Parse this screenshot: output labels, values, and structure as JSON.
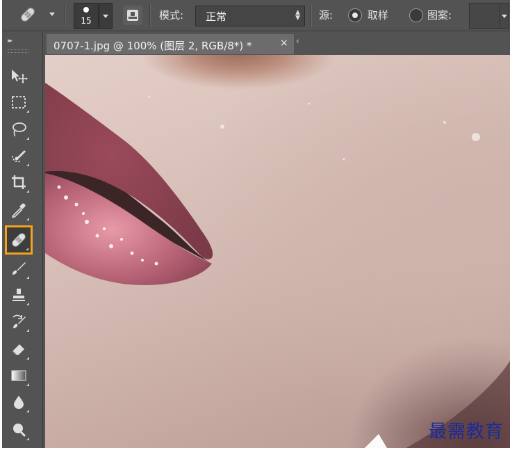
{
  "options_bar": {
    "brush_size": "15",
    "mode_label": "模式:",
    "mode_value": "正常",
    "source_label": "源:",
    "sampled_label": "取样",
    "pattern_label": "图案:",
    "sampled_selected": true
  },
  "document": {
    "tab_title": "0707-1.jpg @ 100% (图层 2, RGB/8*) *",
    "close_glyph": "×",
    "overflow_glyph": "‹"
  },
  "toolbox": {
    "collapse_glyph": "▸▸",
    "tools": [
      {
        "name": "move-tool",
        "icon": "move-icon"
      },
      {
        "name": "marquee-tool",
        "icon": "marquee-icon"
      },
      {
        "name": "lasso-tool",
        "icon": "lasso-icon"
      },
      {
        "name": "quick-selection-tool",
        "icon": "quick-select-icon"
      },
      {
        "name": "crop-tool",
        "icon": "crop-icon"
      },
      {
        "name": "eyedropper-tool",
        "icon": "eyedropper-icon"
      },
      {
        "name": "healing-brush-tool",
        "icon": "bandage-icon",
        "active": true
      },
      {
        "name": "brush-tool",
        "icon": "brush-icon"
      },
      {
        "name": "clone-stamp-tool",
        "icon": "stamp-icon"
      },
      {
        "name": "history-brush-tool",
        "icon": "history-brush-icon"
      },
      {
        "name": "eraser-tool",
        "icon": "eraser-icon"
      },
      {
        "name": "gradient-tool",
        "icon": "gradient-icon"
      },
      {
        "name": "blur-tool",
        "icon": "drop-icon"
      },
      {
        "name": "dodge-tool",
        "icon": "dodge-icon"
      }
    ]
  },
  "watermark": "最需教育",
  "colors": {
    "panel_bg": "#535353",
    "active_tool_border": "#f2a21c",
    "watermark": "#1c2a9a"
  }
}
